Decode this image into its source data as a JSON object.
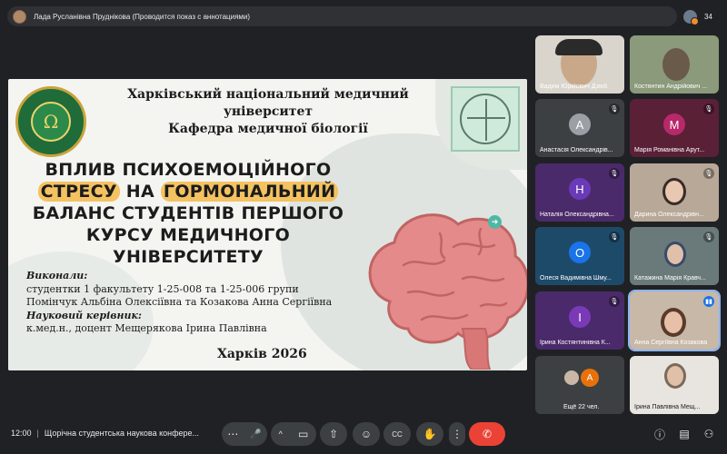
{
  "topbar": {
    "presenter_text": "Лада Русланівна Пруднікова (Проводится показ с аннотациями)",
    "participants_count": "34"
  },
  "slide": {
    "university": "Харківський національний медичний університет",
    "department": "Кафедра медичної біології",
    "topic_lines": [
      {
        "pre": "ВПЛИВ ПСИХОЕМОЦІЙНОГО",
        "hl1": "",
        "mid": "",
        "hl2": ""
      },
      {
        "pre": "",
        "hl1": "СТРЕСУ",
        "mid": " НА ",
        "hl2": "ГОРМОНАЛЬНИЙ"
      },
      {
        "pre": "БАЛАНС СТУДЕНТІВ ПЕРШОГО",
        "hl1": "",
        "mid": "",
        "hl2": ""
      },
      {
        "pre": "КУРСУ МЕДИЧНОГО",
        "hl1": "",
        "mid": "",
        "hl2": ""
      },
      {
        "pre": "УНІВЕРСИТЕТУ",
        "hl1": "",
        "mid": "",
        "hl2": ""
      }
    ],
    "authors_label": "Виконали:",
    "authors_line1": "студентки 1 факультету 1-25-008 та 1-25-006 групи",
    "authors_line2": "Помінчук Альбіна Олексіївна та Козакова Анна Сергіївна",
    "supervisor_label": "Науковий керівник:",
    "supervisor": "к.мед.н., доцент Мещерякова Ірина Павлівна",
    "city_year": "Харків 2026",
    "logo_left_symbol": "Ω"
  },
  "tiles": [
    {
      "name": "Вадим Юрійович Дзюб",
      "type": "video",
      "bg": "#d9d4cc",
      "muted": false
    },
    {
      "name": "Костянтин Андрійович ...",
      "type": "video",
      "bg": "#8a9a7a",
      "muted": false
    },
    {
      "name": "Анастасія Олександрів...",
      "type": "letter",
      "letter": "А",
      "bg": "#3c4043",
      "circle": "#9aa0a6",
      "muted": true
    },
    {
      "name": "Марія Романівна Арут...",
      "type": "letter",
      "letter": "М",
      "bg": "#5a2036",
      "circle": "#b8296b",
      "muted": true
    },
    {
      "name": "Наталія Олександрівна...",
      "type": "letter",
      "letter": "Н",
      "bg": "#4a2a6a",
      "circle": "#6a3ab8",
      "muted": true
    },
    {
      "name": "Дарина Олександрівн...",
      "type": "video",
      "bg": "#b8a898",
      "muted": true
    },
    {
      "name": "Олеся Вадимівна Шму...",
      "type": "letter",
      "letter": "О",
      "bg": "#1e4a6a",
      "circle": "#1a73e8",
      "muted": true
    },
    {
      "name": "Катажина Марія Кравч...",
      "type": "video",
      "bg": "#6a7a7a",
      "muted": true
    },
    {
      "name": "Ірина Костянтинівна К...",
      "type": "letter",
      "letter": "І",
      "bg": "#4a2a6a",
      "circle": "#7a3ab8",
      "muted": true
    },
    {
      "name": "Анна Сергіївна Козакова",
      "type": "video",
      "bg": "#c8b8a8",
      "muted": false,
      "active": true
    },
    {
      "name": "Ещё 22 чел.",
      "type": "more",
      "letter": "А",
      "bg": "#3c4043",
      "circle": "#e8710a",
      "muted": false
    },
    {
      "name": "Ірина Павлівна Мещ...",
      "type": "video",
      "bg": "#e8e4e0",
      "muted": false
    }
  ],
  "bottom": {
    "time": "12:00",
    "separator": "|",
    "meeting_title": "Щорічна студентська наукова конфере..."
  },
  "controls": {
    "more_label": "⋯",
    "mic_icon": "🎤",
    "chevron": "^",
    "camera_icon": "▭",
    "present_icon": "⇧",
    "emoji_icon": "☺",
    "captions_icon": "CC",
    "hand_icon": "✋",
    "options_icon": "⋮",
    "end_call_icon": "✆",
    "info_icon": "ⓘ",
    "chat_icon": "▤",
    "people_icon": "⚇"
  },
  "colors": {
    "background": "#202124",
    "highlight": "#f4c261",
    "end_call": "#ea4335",
    "active_outline": "#8ab4f8"
  }
}
